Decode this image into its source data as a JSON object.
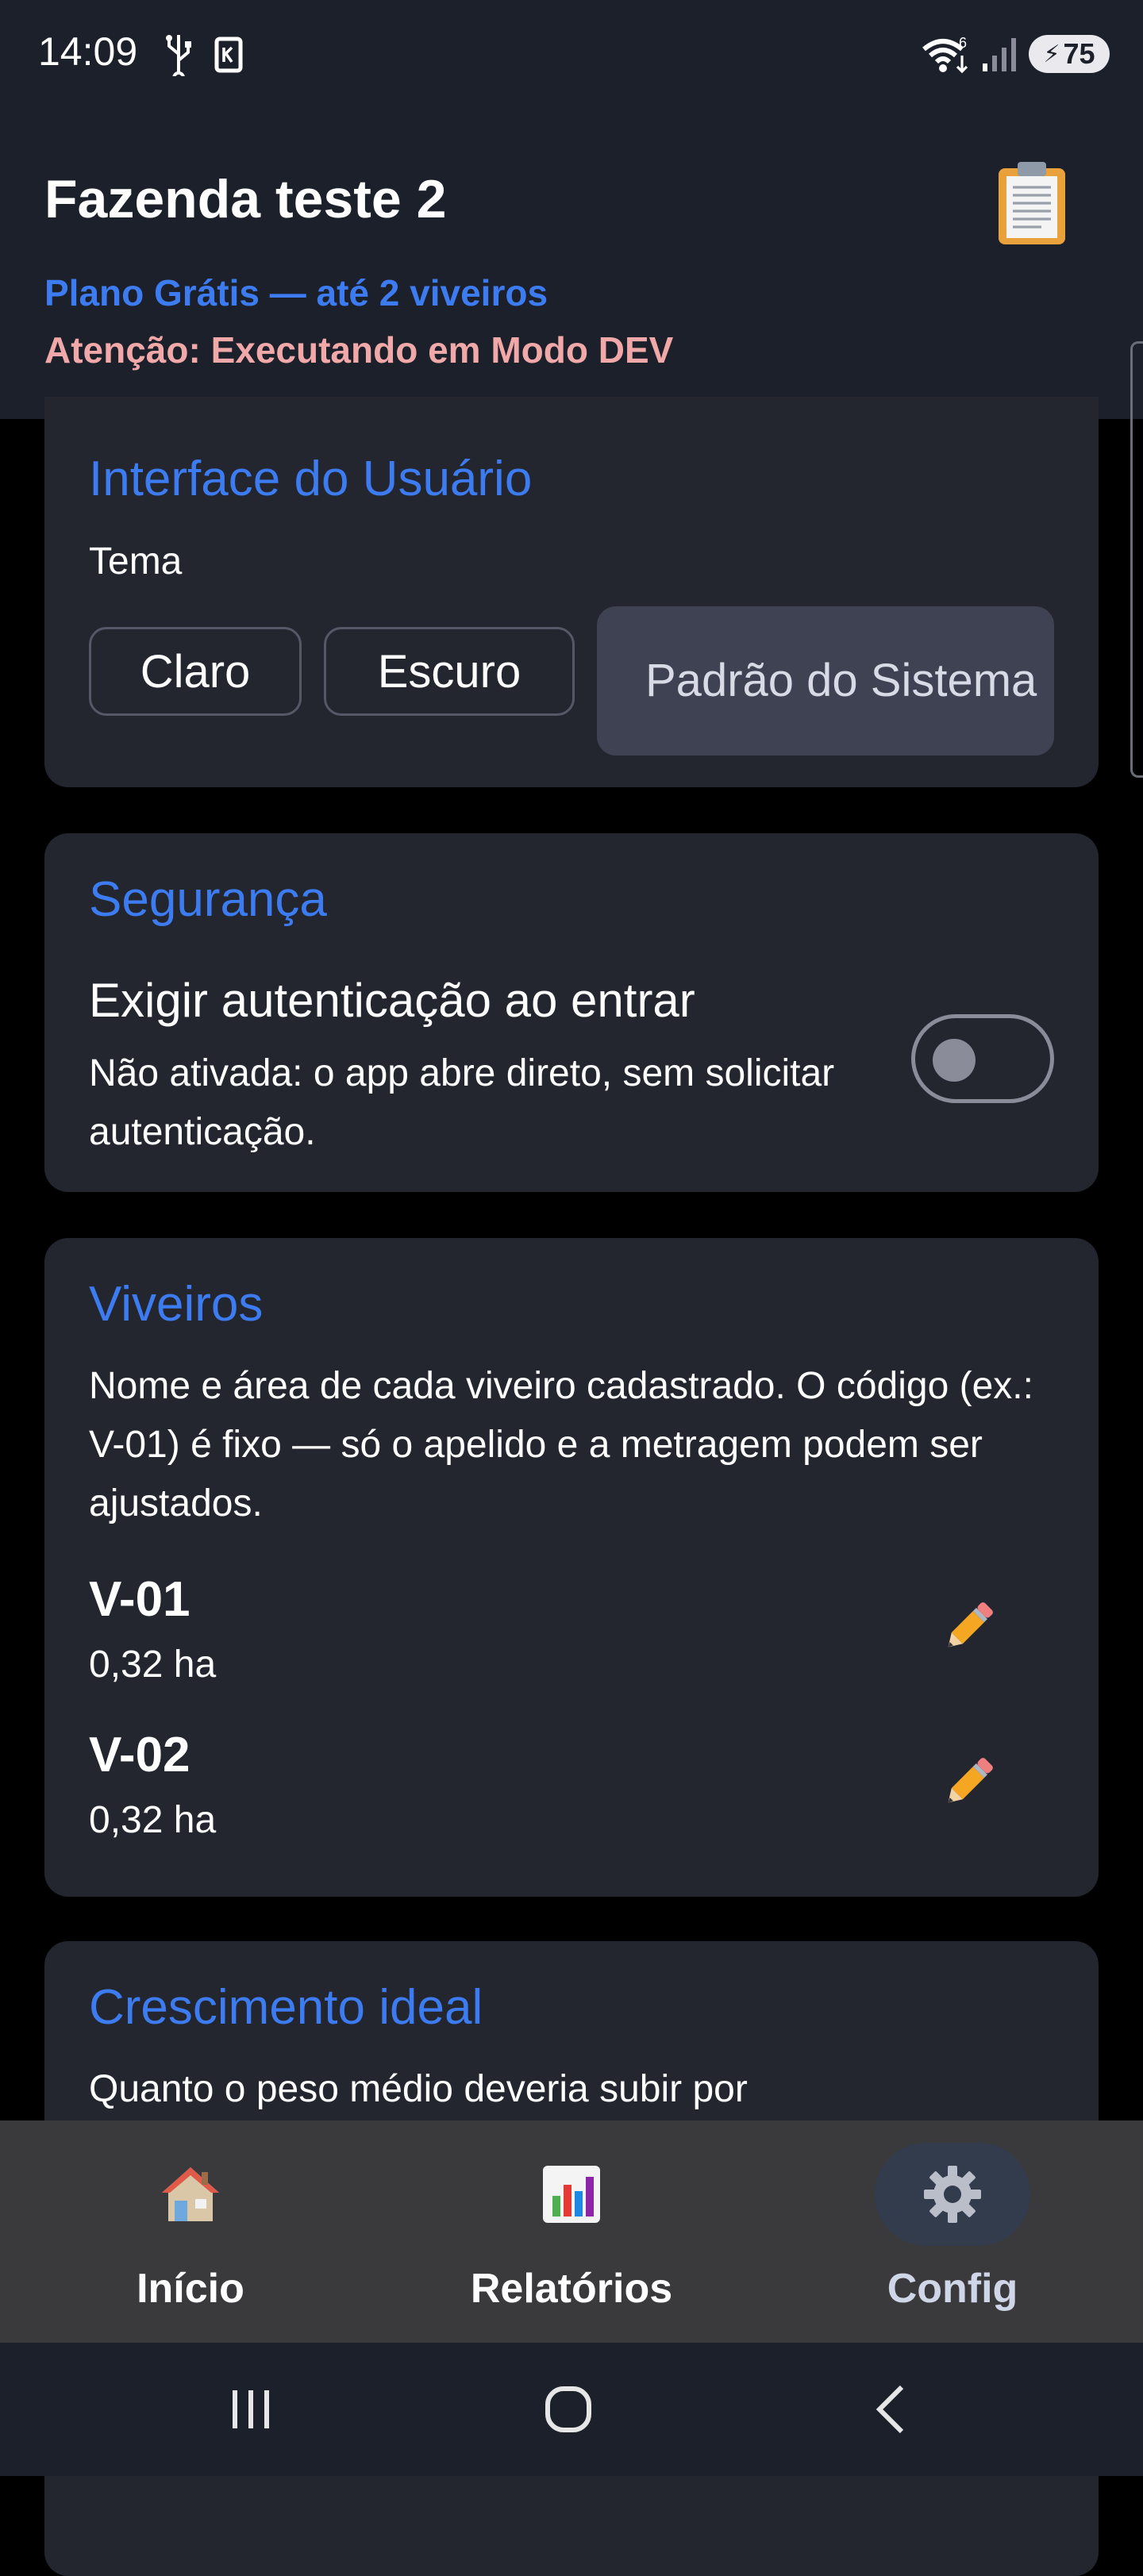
{
  "status_bar": {
    "time": "14:09",
    "battery": "75",
    "icons": [
      "usb-icon",
      "sim-icon",
      "wifi-icon",
      "signal-icon",
      "battery-icon"
    ]
  },
  "header": {
    "farm_name": "Fazenda teste 2",
    "plan": "Plano Grátis — até 2 viveiros",
    "dev_warning": "Atenção: Executando em Modo DEV",
    "clipboard_icon": "clipboard-icon"
  },
  "interface": {
    "title": "Interface do Usuário",
    "theme_label": "Tema",
    "options": [
      "Claro",
      "Escuro",
      "Padrão do Sistema"
    ],
    "selected": "Padrão do Sistema"
  },
  "security": {
    "title": "Segurança",
    "heading": "Exigir autenticação ao entrar",
    "description": "Não ativada: o app abre direto, sem solicitar autenticação.",
    "enabled": false
  },
  "viveiros": {
    "title": "Viveiros",
    "description": "Nome e área de cada viveiro cadastrado. O código (ex.: V-01) é fixo — só o apelido e a metragem podem ser ajustados.",
    "items": [
      {
        "code": "V-01",
        "area": "0,32 ha"
      },
      {
        "code": "V-02",
        "area": "0,32 ha"
      }
    ]
  },
  "growth": {
    "title": "Crescimento ideal",
    "description": "Quanto o peso médio deveria subir por"
  },
  "bottom_nav": {
    "items": [
      {
        "label": "Início",
        "icon": "house-icon"
      },
      {
        "label": "Relatórios",
        "icon": "bar-chart-icon"
      },
      {
        "label": "Config",
        "icon": "gear-icon"
      }
    ],
    "active": "Config"
  },
  "colors": {
    "accent": "#3d7cf0",
    "warning": "#f0a8a8",
    "card": "#23252f",
    "header": "#1c202b"
  }
}
